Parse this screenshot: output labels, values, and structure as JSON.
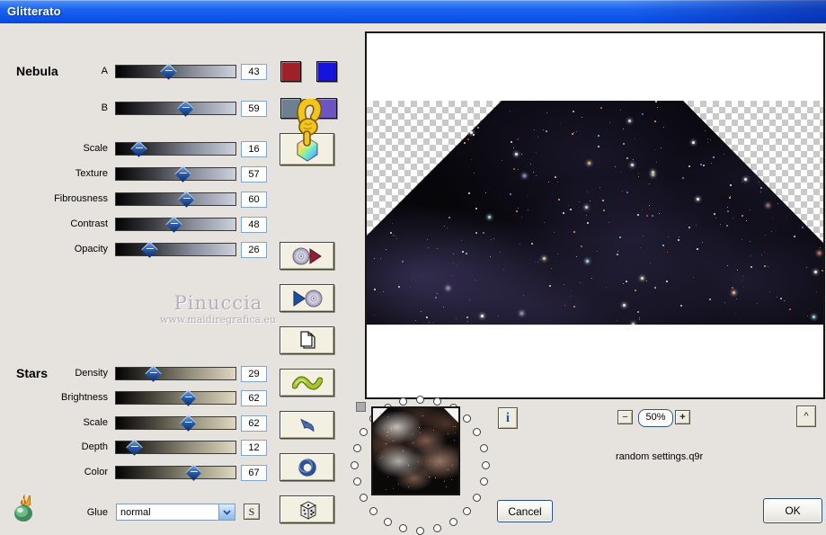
{
  "window": {
    "title": "Glitterato"
  },
  "sections": [
    {
      "label": "Nebula",
      "sliders": [
        {
          "label": "A",
          "value": 43
        },
        {
          "label": "B",
          "value": 59
        },
        {
          "label": "Scale",
          "value": 16
        },
        {
          "label": "Texture",
          "value": 57
        },
        {
          "label": "Fibrousness",
          "value": 60
        },
        {
          "label": "Contrast",
          "value": 48
        },
        {
          "label": "Opacity",
          "value": 26
        }
      ]
    },
    {
      "label": "Stars",
      "sliders": [
        {
          "label": "Density",
          "value": 29
        },
        {
          "label": "Brightness",
          "value": 62
        },
        {
          "label": "Scale",
          "value": 62
        },
        {
          "label": "Depth",
          "value": 12
        },
        {
          "label": "Color",
          "value": 67
        }
      ]
    }
  ],
  "swatches": [
    {
      "name": "nebula-color-a-1",
      "color": "#9e2128"
    },
    {
      "name": "nebula-color-a-2",
      "color": "#1414dd"
    },
    {
      "name": "nebula-color-b-1",
      "color": "#6f7f92"
    },
    {
      "name": "nebula-color-b-2",
      "color": "#6c54c3"
    }
  ],
  "glue": {
    "label": "Glue",
    "value": "normal",
    "shortcut": "S"
  },
  "tool_buttons": [
    {
      "name": "color-picker-button",
      "icon": "rainbow-gem-icon"
    },
    {
      "name": "save-preset-button",
      "icon": "disc-red-play-icon"
    },
    {
      "name": "load-preset-button",
      "icon": "blue-play-disc-icon"
    },
    {
      "name": "copy-settings-button",
      "icon": "pages-icon"
    },
    {
      "name": "wave-button",
      "icon": "green-wave-icon"
    },
    {
      "name": "undo-button",
      "icon": "undo-arrow-icon"
    },
    {
      "name": "ring-button",
      "icon": "ring-icon"
    },
    {
      "name": "random-dice-button",
      "icon": "dice-icon"
    }
  ],
  "watermark": {
    "line1": "Pinuccia",
    "line2": "www.maidiregrafica.eu"
  },
  "preview": {
    "zoom": "50%",
    "zoom_out": "−",
    "zoom_in": "+",
    "collapse": "^",
    "info": "i"
  },
  "footer": {
    "filename": "random settings.q9r",
    "cancel": "Cancel",
    "ok": "OK"
  },
  "colors": {
    "titlebar": "#0b51e8",
    "button_face": "#f3f0e2",
    "dialog": "#e6e3de"
  }
}
